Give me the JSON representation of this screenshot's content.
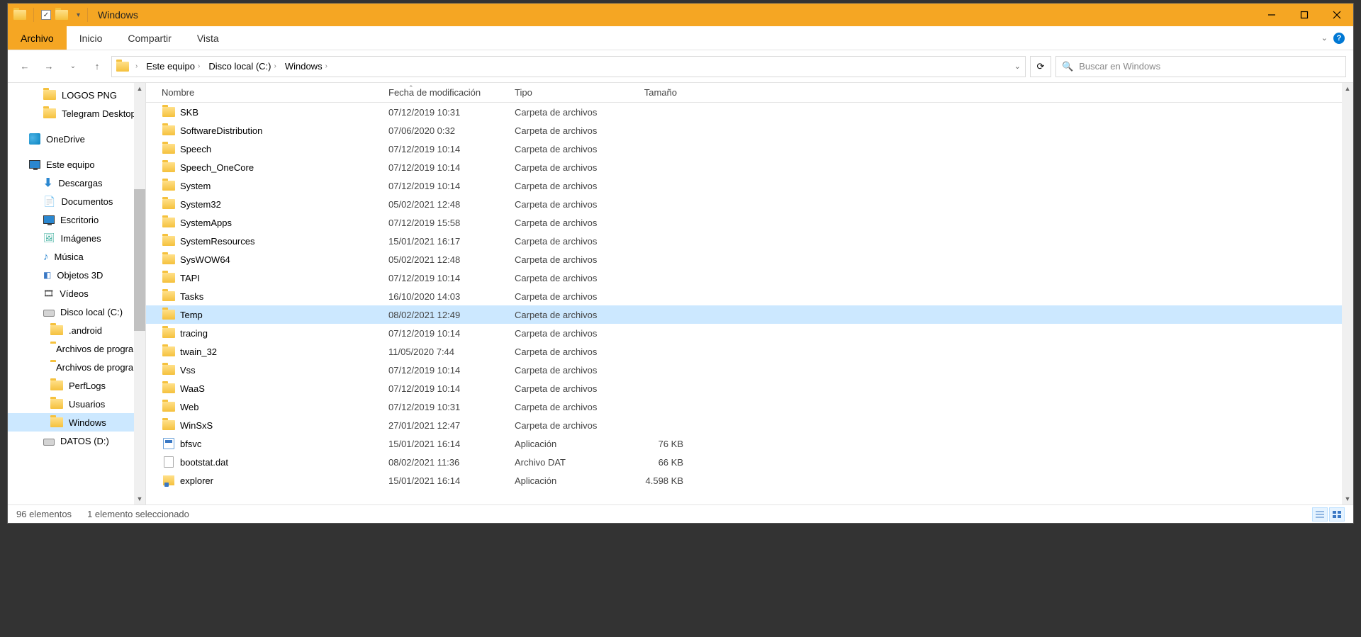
{
  "title": "Windows",
  "ribbon": {
    "file": "Archivo",
    "home": "Inicio",
    "share": "Compartir",
    "view": "Vista"
  },
  "breadcrumbs": [
    "Este equipo",
    "Disco local (C:)",
    "Windows"
  ],
  "search_placeholder": "Buscar en Windows",
  "columns": {
    "name": "Nombre",
    "date": "Fecha de modificación",
    "type": "Tipo",
    "size": "Tamaño"
  },
  "tree": [
    {
      "label": "LOGOS PNG",
      "icon": "folder",
      "indent": 2
    },
    {
      "label": "Telegram Desktop",
      "icon": "folder",
      "indent": 2
    },
    {
      "label": "OneDrive",
      "icon": "onedrive",
      "indent": 1,
      "gap": true
    },
    {
      "label": "Este equipo",
      "icon": "monitor",
      "indent": 1,
      "gap": true
    },
    {
      "label": "Descargas",
      "icon": "download",
      "indent": 2
    },
    {
      "label": "Documentos",
      "icon": "doc",
      "indent": 2
    },
    {
      "label": "Escritorio",
      "icon": "desktop",
      "indent": 2
    },
    {
      "label": "Imágenes",
      "icon": "image",
      "indent": 2
    },
    {
      "label": "Música",
      "icon": "music",
      "indent": 2
    },
    {
      "label": "Objetos 3D",
      "icon": "3d",
      "indent": 2
    },
    {
      "label": "Vídeos",
      "icon": "video",
      "indent": 2
    },
    {
      "label": "Disco local (C:)",
      "icon": "drive",
      "indent": 2
    },
    {
      "label": ".android",
      "icon": "folder",
      "indent": 3
    },
    {
      "label": "Archivos de programa",
      "icon": "folder",
      "indent": 3
    },
    {
      "label": "Archivos de programa",
      "icon": "folder",
      "indent": 3
    },
    {
      "label": "PerfLogs",
      "icon": "folder",
      "indent": 3
    },
    {
      "label": "Usuarios",
      "icon": "folder",
      "indent": 3
    },
    {
      "label": "Windows",
      "icon": "folder",
      "indent": 3,
      "selected": true
    },
    {
      "label": "DATOS (D:)",
      "icon": "drive",
      "indent": 2
    }
  ],
  "files": [
    {
      "name": "SKB",
      "date": "07/12/2019 10:31",
      "type": "Carpeta de archivos",
      "size": "",
      "icon": "folder"
    },
    {
      "name": "SoftwareDistribution",
      "date": "07/06/2020 0:32",
      "type": "Carpeta de archivos",
      "size": "",
      "icon": "folder"
    },
    {
      "name": "Speech",
      "date": "07/12/2019 10:14",
      "type": "Carpeta de archivos",
      "size": "",
      "icon": "folder"
    },
    {
      "name": "Speech_OneCore",
      "date": "07/12/2019 10:14",
      "type": "Carpeta de archivos",
      "size": "",
      "icon": "folder"
    },
    {
      "name": "System",
      "date": "07/12/2019 10:14",
      "type": "Carpeta de archivos",
      "size": "",
      "icon": "folder"
    },
    {
      "name": "System32",
      "date": "05/02/2021 12:48",
      "type": "Carpeta de archivos",
      "size": "",
      "icon": "folder"
    },
    {
      "name": "SystemApps",
      "date": "07/12/2019 15:58",
      "type": "Carpeta de archivos",
      "size": "",
      "icon": "folder"
    },
    {
      "name": "SystemResources",
      "date": "15/01/2021 16:17",
      "type": "Carpeta de archivos",
      "size": "",
      "icon": "folder"
    },
    {
      "name": "SysWOW64",
      "date": "05/02/2021 12:48",
      "type": "Carpeta de archivos",
      "size": "",
      "icon": "folder"
    },
    {
      "name": "TAPI",
      "date": "07/12/2019 10:14",
      "type": "Carpeta de archivos",
      "size": "",
      "icon": "folder"
    },
    {
      "name": "Tasks",
      "date": "16/10/2020 14:03",
      "type": "Carpeta de archivos",
      "size": "",
      "icon": "folder"
    },
    {
      "name": "Temp",
      "date": "08/02/2021 12:49",
      "type": "Carpeta de archivos",
      "size": "",
      "icon": "folder",
      "selected": true
    },
    {
      "name": "tracing",
      "date": "07/12/2019 10:14",
      "type": "Carpeta de archivos",
      "size": "",
      "icon": "folder"
    },
    {
      "name": "twain_32",
      "date": "11/05/2020 7:44",
      "type": "Carpeta de archivos",
      "size": "",
      "icon": "folder"
    },
    {
      "name": "Vss",
      "date": "07/12/2019 10:14",
      "type": "Carpeta de archivos",
      "size": "",
      "icon": "folder"
    },
    {
      "name": "WaaS",
      "date": "07/12/2019 10:14",
      "type": "Carpeta de archivos",
      "size": "",
      "icon": "folder"
    },
    {
      "name": "Web",
      "date": "07/12/2019 10:31",
      "type": "Carpeta de archivos",
      "size": "",
      "icon": "folder"
    },
    {
      "name": "WinSxS",
      "date": "27/01/2021 12:47",
      "type": "Carpeta de archivos",
      "size": "",
      "icon": "folder"
    },
    {
      "name": "bfsvc",
      "date": "15/01/2021 16:14",
      "type": "Aplicación",
      "size": "76 KB",
      "icon": "exe"
    },
    {
      "name": "bootstat.dat",
      "date": "08/02/2021 11:36",
      "type": "Archivo DAT",
      "size": "66 KB",
      "icon": "file"
    },
    {
      "name": "explorer",
      "date": "15/01/2021 16:14",
      "type": "Aplicación",
      "size": "4.598 KB",
      "icon": "explorer"
    }
  ],
  "status": {
    "count": "96 elementos",
    "sel": "1 elemento seleccionado"
  }
}
